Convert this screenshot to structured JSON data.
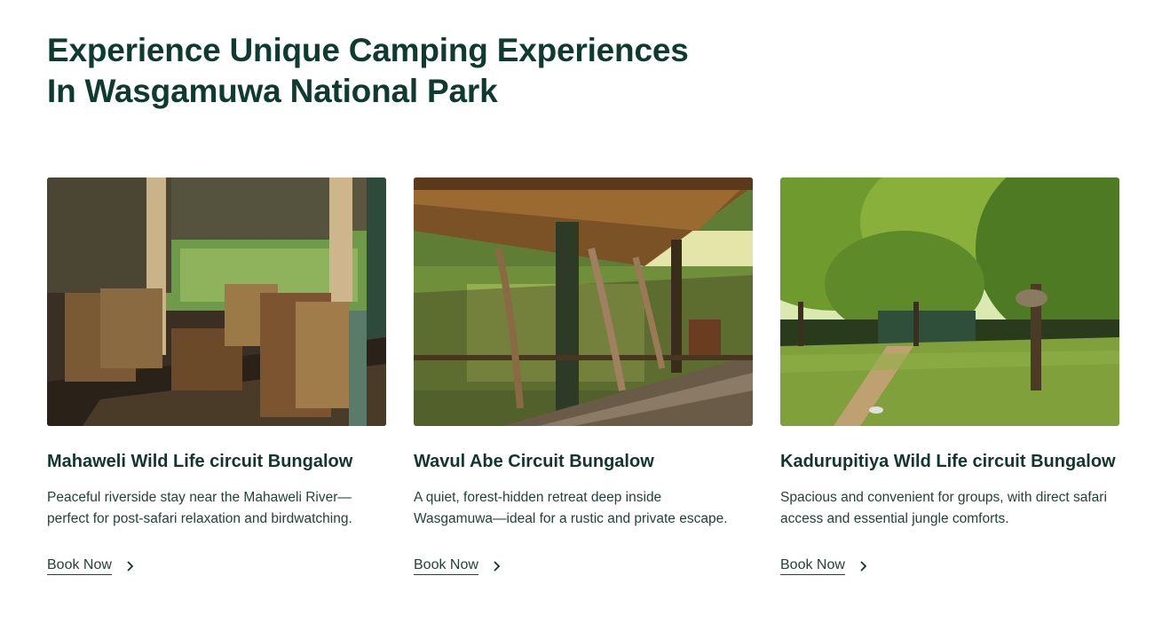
{
  "header": {
    "line1": "Experience Unique Camping Experiences",
    "line2": "In Wasgamuwa National Park"
  },
  "cards": [
    {
      "title": "Mahaweli Wild Life circuit Bungalow",
      "description": " Peaceful riverside stay near the Mahaweli River—\nperfect for post-safari relaxation and birdwatching.",
      "cta": "Book Now",
      "image": "veranda-with-wooden-chairs"
    },
    {
      "title": "Wavul Abe Circuit Bungalow",
      "description": " A quiet, forest-hidden retreat deep inside\nWasgamuwa—ideal for a rustic and private escape.",
      "cta": "Book Now",
      "image": "porch-with-antlers"
    },
    {
      "title": "Kadurupitiya Wild Life circuit Bungalow",
      "description": " Spacious and convenient for groups, with direct safari\naccess and essential jungle comforts.",
      "cta": "Book Now",
      "image": "trees-and-lawn"
    }
  ],
  "colors": {
    "heading": "#0f3a30",
    "text": "#23413a"
  }
}
